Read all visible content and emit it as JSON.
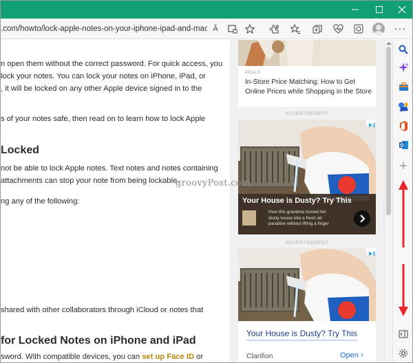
{
  "browser": {
    "url_visible": ".com/howto/lock-apple-notes-on-your-iphone-ipad-and-mac/",
    "read_aloud_glyph": "Ă"
  },
  "article": {
    "lines": [
      "n open them without the correct password. For quick access, you",
      "lock your notes. You can lock your notes on iPhone, iPad, or",
      ", it will be locked on any other Apple device signed in to the",
      "s of your notes safe, then read on to learn how to lock Apple",
      "not be able to lock Apple notes. Text notes and notes containing",
      "attachments can stop your note from being lockable.",
      "ng any of the following:",
      "shared with other collaborators through iCloud or notes that"
    ],
    "heading_locked": "Locked",
    "heading_face_id": "for Locked Notes on iPhone and iPad",
    "last_line_prefix": "sword. With compatible devices, you can ",
    "last_line_link": "set up Face ID",
    "last_line_suffix": " or"
  },
  "sidebar": {
    "story_category": "DEALS",
    "story_title_1": "In-Store Price Matching: How to Get",
    "story_title_2": "Online Prices while Shopping in the Store",
    "ad_label": "ADVERTISEMENT",
    "ad1": {
      "headline": "Your House is Dusty? Try This",
      "body_1": "How this grandma turned her",
      "body_2": "dusty house into a fresh air",
      "body_3": "paradise without lifting a finger"
    },
    "ad2": {
      "headline": "Your House is Dusty? Try This",
      "brand": "Clarifion",
      "cta": "Open",
      "cta_arrow": "›"
    }
  },
  "watermark": "groovyPost.com",
  "colors": {
    "titlebar": "#10a071",
    "annotation_arrow": "#e8262b",
    "link": "#b8860b"
  }
}
